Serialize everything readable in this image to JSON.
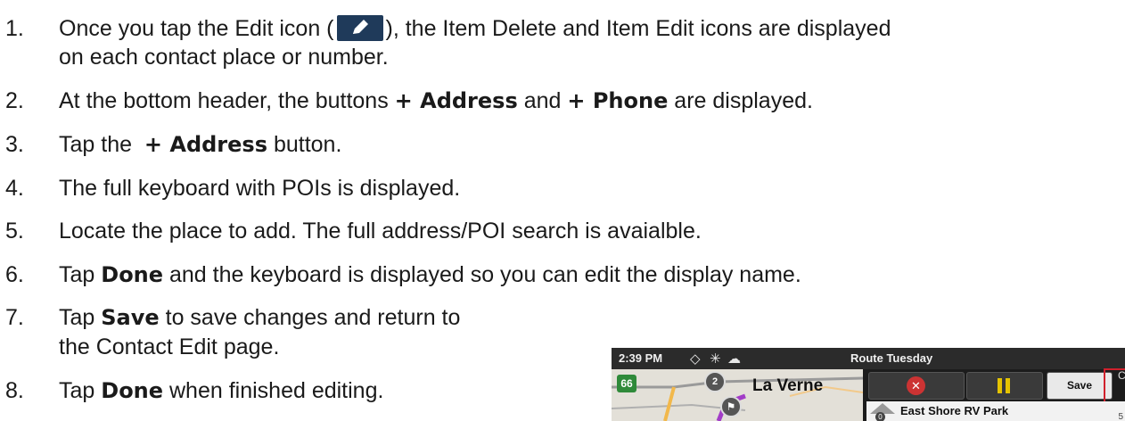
{
  "steps": [
    {
      "num": "1.",
      "pre": "Once you tap the Edit icon (",
      "post": "), the Item Delete and Item Edit icons are displayed",
      "line2": "on each contact place or number."
    },
    {
      "num": "2.",
      "pre": "At the bottom header, the buttons ",
      "b1": "+ Address",
      "mid": " and ",
      "b2": "+ Phone",
      "post": " are displayed."
    },
    {
      "num": "3.",
      "pre": "Tap the  ",
      "b1": "+ Address",
      "post": " button."
    },
    {
      "num": "4.",
      "text": "The full keyboard with POIs is displayed."
    },
    {
      "num": "5.",
      "text": "Locate the place to add. The full address/POI search is avaialble."
    },
    {
      "num": "6.",
      "pre": "Tap ",
      "b1": "Done",
      "post": " and the keyboard is displayed so you can edit the display name."
    },
    {
      "num": "7.",
      "pre": "Tap ",
      "b1": "Save",
      "post": " to save changes and return to",
      "line2": "the Contact Edit page."
    },
    {
      "num": "8.",
      "pre": "Tap ",
      "b1": "Done",
      "post": " when finished editing."
    }
  ],
  "device": {
    "time": "2:39 PM",
    "route_title": "Route Tuesday",
    "city": "La Verne",
    "shield": "66",
    "marker_num": "2",
    "save_label": "Save",
    "next_hint": "C",
    "destination": "East Shore RV Park",
    "dist": "5",
    "dest_marker": "0"
  },
  "icons": [
    "edit-pencil-icon",
    "wifi-icon",
    "bluetooth-icon",
    "cloud-icon",
    "cancel-icon",
    "pause-icon",
    "turn-arrow-icon"
  ],
  "colors": {
    "edit_icon_bg": "#1f3a5a",
    "highlight": "#d0202c",
    "route": "#a23cc7"
  }
}
